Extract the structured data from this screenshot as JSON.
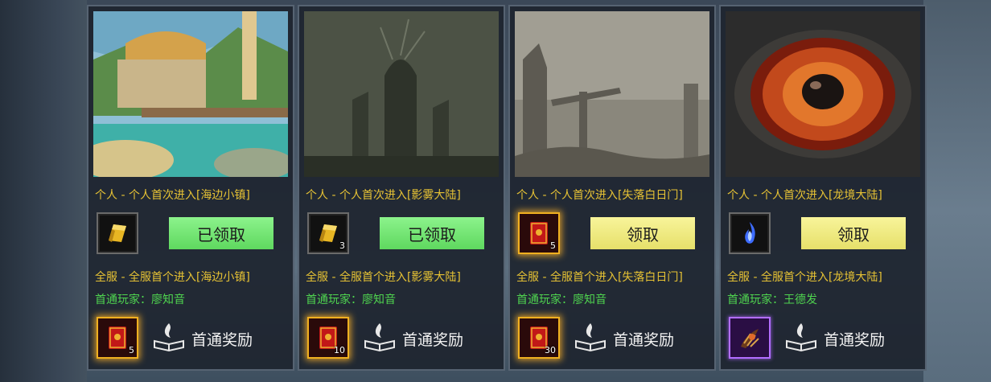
{
  "cards": [
    {
      "personal_text": "个人 - 个人首次进入[海边小镇]",
      "personal_reward_count": "",
      "claim_label": "已领取",
      "claim_state": "claimed",
      "server_text": "全服 - 全服首个进入[海边小镇]",
      "first_player_label": "首通玩家：",
      "first_player_name": "廖知音",
      "first_reward_count": "5",
      "first_reward_label": "首通奖励"
    },
    {
      "personal_text": "个人 - 个人首次进入[影雾大陆]",
      "personal_reward_count": "3",
      "claim_label": "已领取",
      "claim_state": "claimed",
      "server_text": "全服 - 全服首个进入[影雾大陆]",
      "first_player_label": "首通玩家：",
      "first_player_name": "廖知音",
      "first_reward_count": "10",
      "first_reward_label": "首通奖励"
    },
    {
      "personal_text": "个人 - 个人首次进入[失落白日门]",
      "personal_reward_count": "5",
      "claim_label": "领取",
      "claim_state": "ready",
      "server_text": "全服 - 全服首个进入[失落白日门]",
      "first_player_label": "首通玩家：",
      "first_player_name": "廖知音",
      "first_reward_count": "30",
      "first_reward_label": "首通奖励"
    },
    {
      "personal_text": "个人 - 个人首次进入[龙境大陆]",
      "personal_reward_count": "",
      "claim_label": "领取",
      "claim_state": "ready",
      "server_text": "全服 - 全服首个进入[龙境大陆]",
      "first_player_label": "首通玩家：",
      "first_player_name": "王德发",
      "first_reward_count": "",
      "first_reward_label": "首通奖励"
    }
  ],
  "colors": {
    "gold_text": "#e6c234",
    "green_text": "#4fd44f",
    "claimed_button": "#6fe26f",
    "ready_button": "#efea7c"
  },
  "icons": [
    "gold-bar-icon",
    "red-book-icon",
    "blue-flame-icon",
    "purple-claw-icon",
    "open-book-flame-icon"
  ]
}
